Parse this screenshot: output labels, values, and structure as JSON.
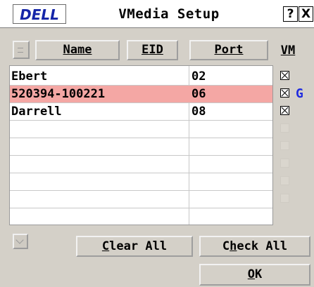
{
  "window": {
    "logo_text": "DELL",
    "title": "VMedia Setup",
    "help_label": "?",
    "close_label": "X"
  },
  "columns": {
    "name": {
      "mnemonic": "N",
      "rest": "ame"
    },
    "eid": {
      "mnemonic": "E",
      "rest": "ID"
    },
    "port": {
      "mnemonic": "P",
      "rest": "ort"
    },
    "vm": {
      "mnemonic": "V",
      "rest": "M"
    }
  },
  "rows": [
    {
      "name": "Ebert",
      "port": "02",
      "vm_checked": true,
      "vm_flag": "",
      "selected": false
    },
    {
      "name": "520394-100221",
      "port": "06",
      "vm_checked": true,
      "vm_flag": "G",
      "selected": true
    },
    {
      "name": "Darrell",
      "port": "08",
      "vm_checked": true,
      "vm_flag": "",
      "selected": false
    },
    {
      "name": "",
      "port": "",
      "vm_checked": false,
      "vm_flag": "",
      "selected": false
    },
    {
      "name": "",
      "port": "",
      "vm_checked": false,
      "vm_flag": "",
      "selected": false
    },
    {
      "name": "",
      "port": "",
      "vm_checked": false,
      "vm_flag": "",
      "selected": false
    },
    {
      "name": "",
      "port": "",
      "vm_checked": false,
      "vm_flag": "",
      "selected": false
    },
    {
      "name": "",
      "port": "",
      "vm_checked": false,
      "vm_flag": "",
      "selected": false
    }
  ],
  "buttons": {
    "clear_all": {
      "mnemonic": "C",
      "rest": "lear All"
    },
    "check_all": {
      "mnemonic": "h",
      "prefix": "C",
      "rest": "eck All"
    },
    "ok": {
      "mnemonic": "O",
      "rest": "K"
    }
  },
  "colors": {
    "selected_row": "#f4a7a4",
    "flag": "#1f2be0",
    "logo": "#1525a8"
  }
}
